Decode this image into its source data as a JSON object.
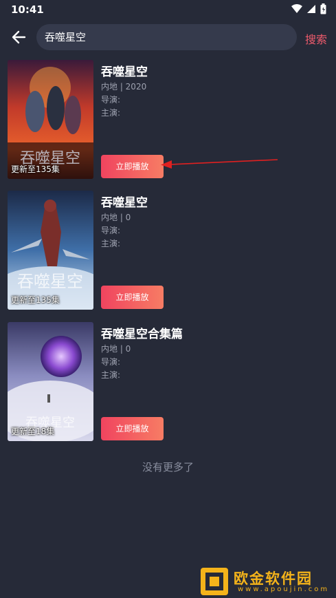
{
  "status_bar": {
    "time": "10:41"
  },
  "header": {
    "search_value": "吞噬星空",
    "search_button": "搜索"
  },
  "results": [
    {
      "title": "吞噬星空",
      "meta": "内地 | 2020",
      "director": "导演:",
      "actors": "主演:",
      "update": "更新至135集",
      "play": "立即播放"
    },
    {
      "title": "吞噬星空",
      "meta": "内地 | 0",
      "director": "导演:",
      "actors": "主演:",
      "update": "更新至135集",
      "play": "立即播放"
    },
    {
      "title": "吞噬星空合集篇",
      "meta": "内地 | 0",
      "director": "导演:",
      "actors": "主演:",
      "update": "更新至18集",
      "play": "立即播放"
    }
  ],
  "footer": {
    "no_more": "没有更多了"
  },
  "watermark": {
    "text": "欧金软件园",
    "url": "www.apoujin.com"
  }
}
